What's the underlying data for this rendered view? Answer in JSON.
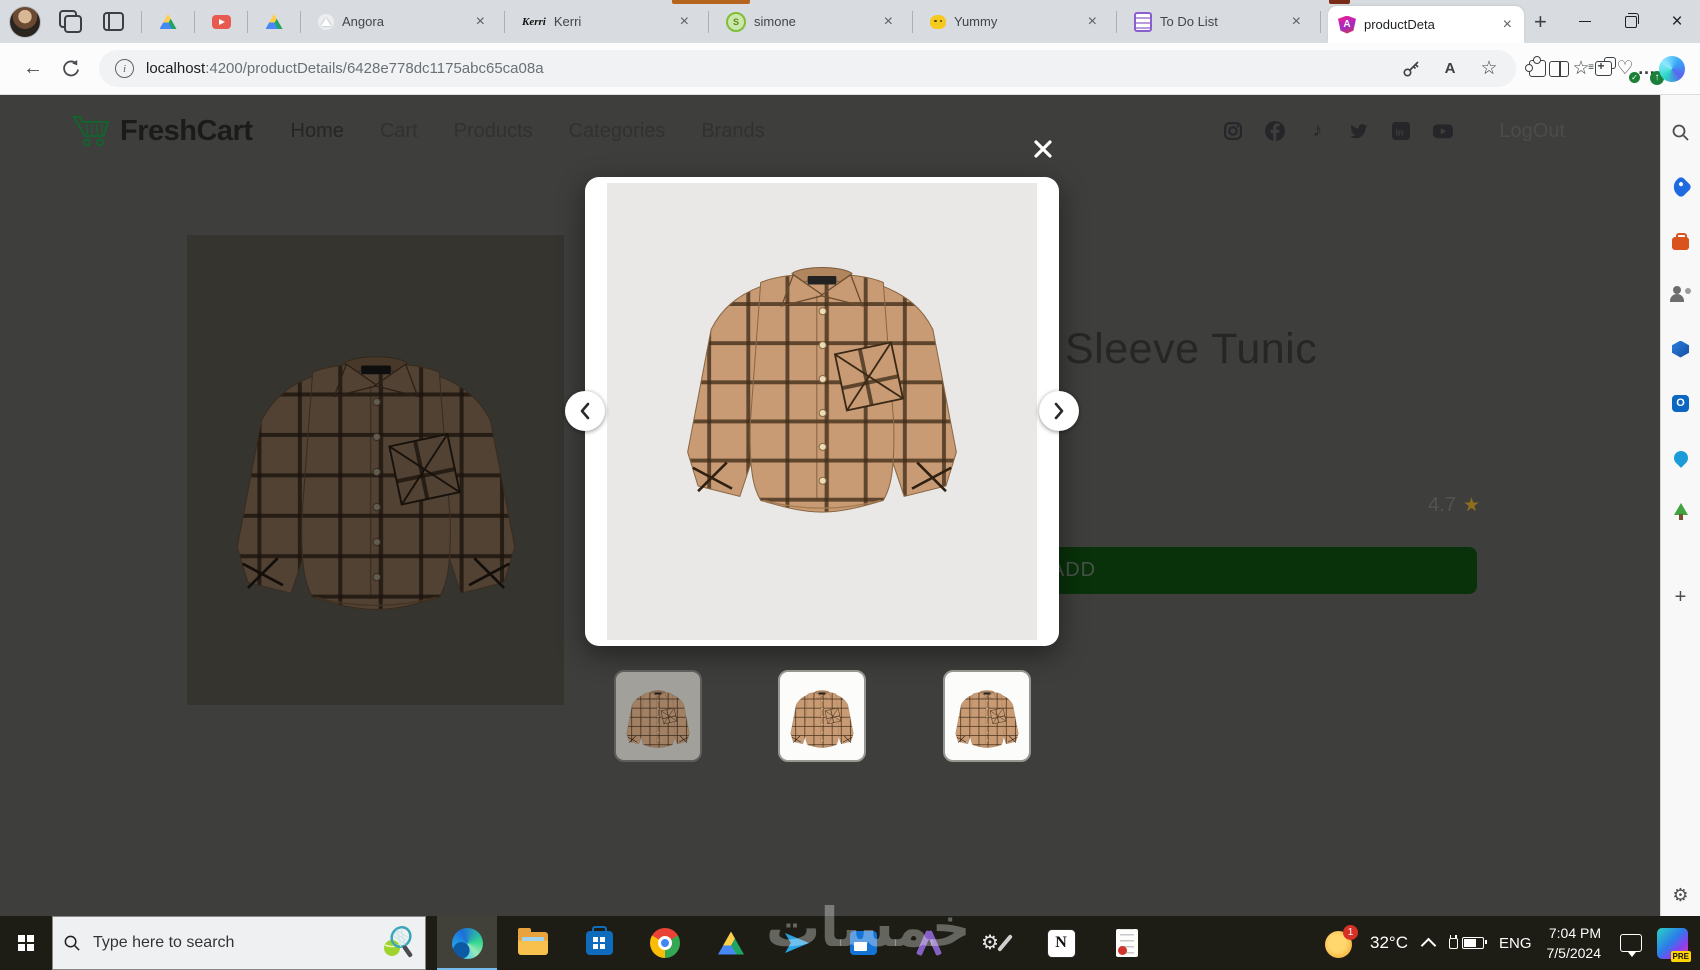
{
  "browser": {
    "tabs": [
      {
        "label": "Angora"
      },
      {
        "label": "Kerri",
        "logo_text": "Kerri"
      },
      {
        "label": "simone",
        "badge": "S"
      },
      {
        "label": "Yummy"
      },
      {
        "label": "To Do List"
      },
      {
        "label": "productDeta",
        "badge": "A",
        "active": true
      }
    ],
    "url": {
      "host": "localhost",
      "rest": ":4200/productDetails/6428e778dc1175abc65ca08a"
    }
  },
  "header": {
    "brand": "FreshCart",
    "nav": [
      {
        "label": "Home"
      },
      {
        "label": "Cart"
      },
      {
        "label": "Products"
      },
      {
        "label": "Categories"
      },
      {
        "label": "Brands"
      }
    ],
    "logout": "LogOut"
  },
  "product": {
    "title_visible": "Sleeve Tunic",
    "rating": "4.7",
    "add_button": "ADD"
  },
  "taskbar": {
    "search_placeholder": "Type here to search",
    "temperature": "32°C",
    "notification_count": "1",
    "language": "ENG",
    "time": "7:04 PM",
    "date": "7/5/2024",
    "pre_badge": "PRE"
  },
  "watermark": "خمسات",
  "icons": {
    "close": "×",
    "back": "←",
    "plus": "+",
    "star": "★",
    "star_outline": "☆",
    "dots": "…",
    "up_arrow": "↑",
    "gear": "⚙",
    "heart": "♡",
    "music_note": "♪",
    "info": "i",
    "read_aloud": "A",
    "linkedin": "in",
    "notion": "N",
    "outlook": "O",
    "menu_lines": "≡",
    "check": "✓"
  },
  "colors": {
    "brand_green": "#0aad0a",
    "dimmed_overlay_bg": "#3e3e3c",
    "add_button_green": "#09310a",
    "star_gold": "#8f6d1e",
    "taskbar_bg": "#1d1d15",
    "tab_group_orange": "#b5651d",
    "angular_pink": "#e0219c"
  }
}
